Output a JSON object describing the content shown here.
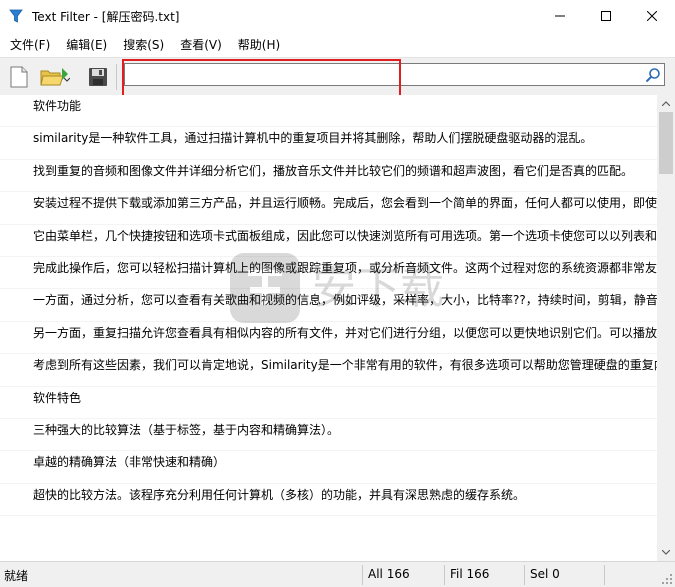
{
  "window": {
    "title": "Text Filter - [解压密码.txt]",
    "controls": [
      "minimize",
      "maximize",
      "close"
    ]
  },
  "menu": [
    "文件(F)",
    "编辑(E)",
    "搜索(S)",
    "查看(V)",
    "帮助(H)"
  ],
  "toolbar": {
    "icons": [
      "new-file-icon",
      "open-folder-icon",
      "save-icon"
    ],
    "search": {
      "value": "",
      "placeholder": ""
    }
  },
  "content": {
    "lines": [
      "软件功能",
      "similarity是一种软件工具，通过扫描计算机中的重复项目并将其删除，帮助人们摆脱硬盘驱动器的混乱。",
      "找到重复的音频和图像文件并详细分析它们，播放音乐文件并比较它们的频谱和超声波图，看它们是否真的匹配。",
      "安装过程不提供下载或添加第三方产品，并且运行顺畅。完成后，您会看到一个简单的界面，任何人都可以使用，即使",
      "它由菜单栏，几个快捷按钮和选项卡式面板组成，因此您可以快速浏览所有可用选项。第一个选项卡使您可以以列表和",
      "完成此操作后，您可以轻松扫描计算机上的图像或跟踪重复项，或分析音频文件。这两个过程对您的系统资源都非常友",
      "一方面，通过分析，您可以查看有关歌曲和视频的信息，例如评级，采样率，大小，比特率??，持续时间，剪辑，静音",
      "另一方面，重复扫描允许您查看具有相似内容的所有文件，并对它们进行分组，以便您可以更快地识别它们。可以播放",
      "考虑到所有这些因素，我们可以肯定地说，Similarity是一个非常有用的软件，有很多选项可以帮助您管理硬盘的重复内",
      "软件特色",
      "三种强大的比较算法（基于标签，基于内容和精确算法）。",
      "卓越的精确算法（非常快速和精确）",
      "超快的比较方法。该程序充分利用任何计算机（多核）的功能，并具有深思熟虑的缓存系统。"
    ]
  },
  "status": {
    "ready": "就绪",
    "all": "All  166",
    "fil": "Fil  166",
    "sel": "Sel  0"
  },
  "colors": {
    "highlight": "#e02020",
    "toolbar_bg": "#f0f0f0"
  }
}
